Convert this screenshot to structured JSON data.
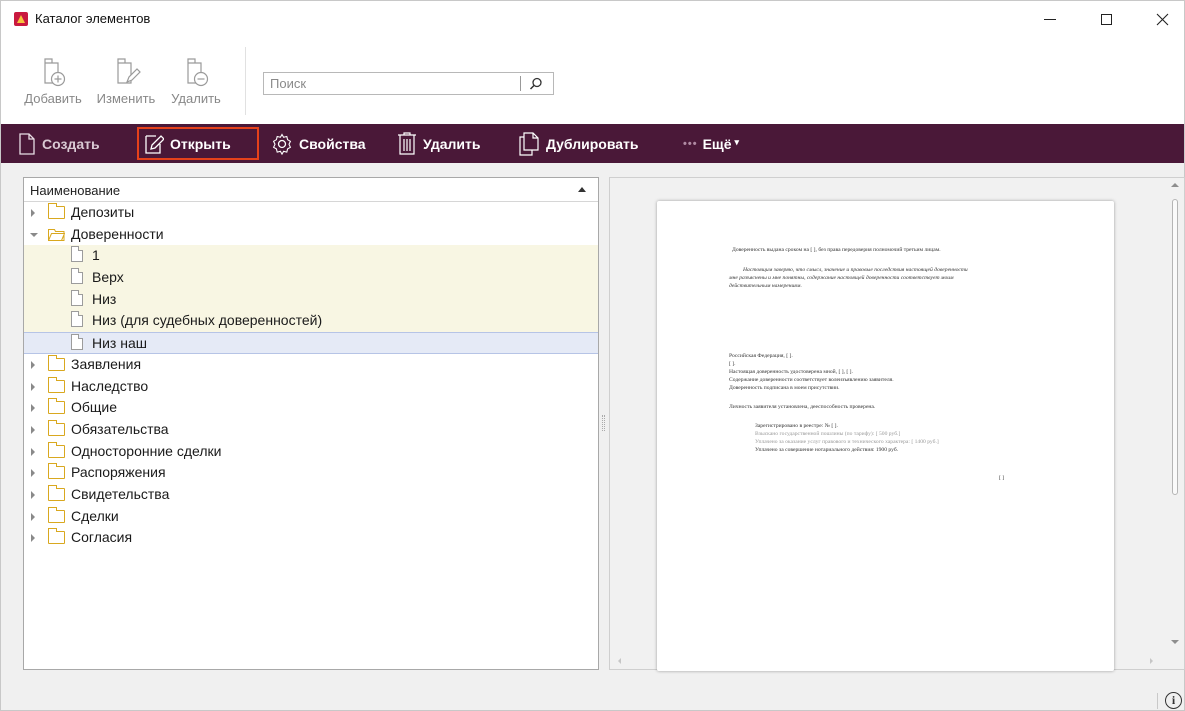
{
  "window": {
    "title": "Каталог элементов",
    "controls": {
      "minimize": "minimize",
      "maximize": "maximize",
      "close": "close"
    }
  },
  "ribbon": {
    "add_label": "Добавить",
    "edit_label": "Изменить",
    "delete_label": "Удалить",
    "search_placeholder": "Поиск"
  },
  "toolbar": {
    "create_label": "Создать",
    "open_label": "Открыть",
    "properties_label": "Свойства",
    "delete_label": "Удалить",
    "duplicate_label": "Дублировать",
    "more_label": "Ещё",
    "accent_color": "#4a1838",
    "highlight_color": "#e6411a"
  },
  "tree": {
    "header": "Наименование",
    "items": [
      {
        "label": "Депозиты",
        "type": "folder",
        "expanded": false
      },
      {
        "label": "Доверенности",
        "type": "folder",
        "expanded": true,
        "children": [
          "1",
          "Верх",
          "Низ",
          "Низ (для судебных доверенностей)",
          "Низ наш"
        ],
        "selected_child": "Низ наш"
      },
      {
        "label": "Заявления",
        "type": "folder",
        "expanded": false
      },
      {
        "label": "Наследство",
        "type": "folder",
        "expanded": false
      },
      {
        "label": "Общие",
        "type": "folder",
        "expanded": false
      },
      {
        "label": "Обязательства",
        "type": "folder",
        "expanded": false
      },
      {
        "label": "Односторонние сделки",
        "type": "folder",
        "expanded": false
      },
      {
        "label": "Распоряжения",
        "type": "folder",
        "expanded": false
      },
      {
        "label": "Свидетельства",
        "type": "folder",
        "expanded": false
      },
      {
        "label": "Сделки",
        "type": "folder",
        "expanded": false
      },
      {
        "label": "Согласия",
        "type": "folder",
        "expanded": false
      }
    ]
  },
  "preview": {
    "lines": [
      "Доверенность выдана сроком на [ ], без права передоверия полномочий третьим лицам.",
      "Настоящим заверяю, что смысл, значение и правовые последствия настоящей доверенности",
      "мне разъяснены и мне понятны, содержание настоящей доверенности соответствует моим",
      "действительным намерениям.",
      "Российская Федерация, [ ].",
      "[ ].",
      "Настоящая доверенность удостоверена мной, [ ], [ ].",
      "Содержание доверенности соответствует волеизъявлению заявителя.",
      "Доверенность подписана в моем присутствии.",
      "Личность заявителя установлена, дееспособность проверена.",
      "Зарегистрировано в реестре: № [ ].",
      "Взыскано государственной пошлины (по тарифу): [ 500 руб.]",
      "Уплачено за оказание услуг правового и технического характера: [ 1400 руб.]",
      "Уплачено за совершение нотариального действия: 1900 руб.",
      "[ ]"
    ]
  },
  "status": {
    "info_icon": "info-icon"
  }
}
